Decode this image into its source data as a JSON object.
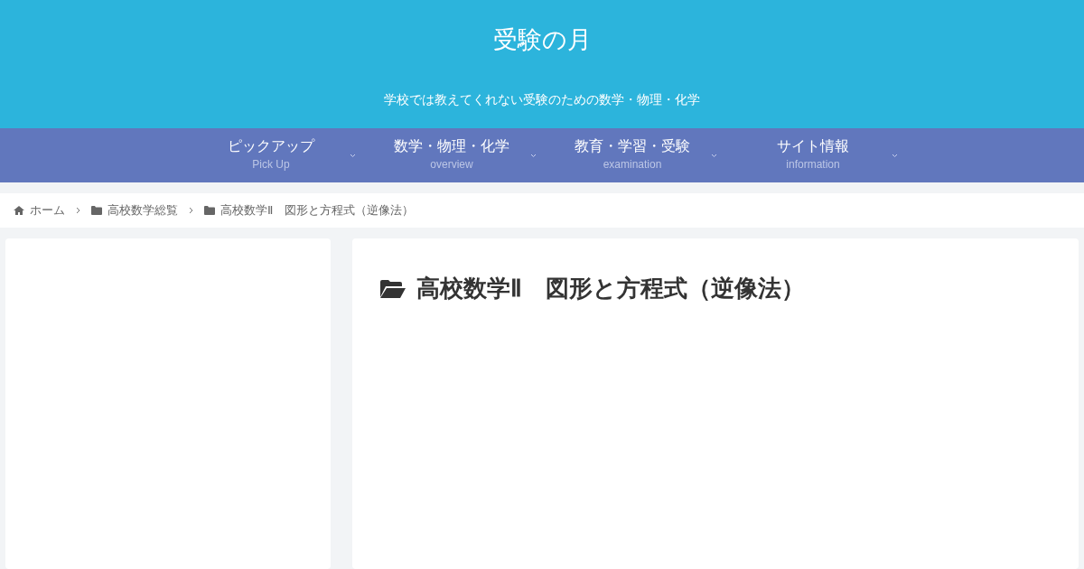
{
  "site": {
    "title": "受験の月",
    "tagline": "学校では教えてくれない受験のための数学・物理・化学"
  },
  "nav": [
    {
      "label": "ピックアップ",
      "sub": "Pick Up"
    },
    {
      "label": "数学・物理・化学",
      "sub": "overview"
    },
    {
      "label": "教育・学習・受験",
      "sub": "examination"
    },
    {
      "label": "サイト情報",
      "sub": "information"
    }
  ],
  "breadcrumb": [
    {
      "kind": "home",
      "label": "ホーム"
    },
    {
      "kind": "folder",
      "label": "高校数学総覧"
    },
    {
      "kind": "folder",
      "label": "高校数学Ⅱ　図形と方程式（逆像法）"
    }
  ],
  "page_title": "高校数学Ⅱ　図形と方程式（逆像法）"
}
